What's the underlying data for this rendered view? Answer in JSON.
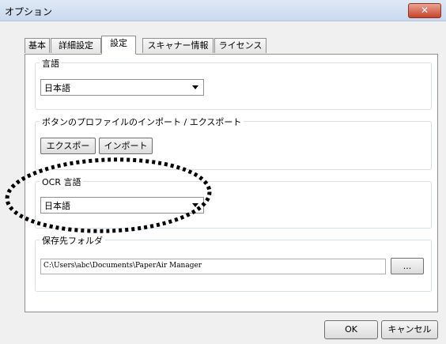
{
  "window": {
    "title": "オプション",
    "close_icon": "✕"
  },
  "tabs": [
    {
      "label": "基本"
    },
    {
      "label": "詳細設定"
    },
    {
      "label": "設定"
    },
    {
      "label": "スキャナー情報"
    },
    {
      "label": "ライセンス"
    }
  ],
  "language": {
    "group_label": "言語",
    "selected": "日本語"
  },
  "button_profile": {
    "group_label": "ボタンのプロファイルのインポート / エクスポート",
    "export_label": "エクスポー",
    "import_label": "インポート"
  },
  "ocr": {
    "group_label": "OCR 言語",
    "selected": "日本語"
  },
  "save_folder": {
    "group_label": "保存先フォルダ",
    "path": "C:\\Users\\abc\\Documents\\PaperAir Manager",
    "browse_label": "..."
  },
  "footer": {
    "ok_label": "OK",
    "cancel_label": "キャンセル"
  },
  "annotation": {
    "color": "#000000",
    "type": "dotted-ellipse-highlight"
  }
}
